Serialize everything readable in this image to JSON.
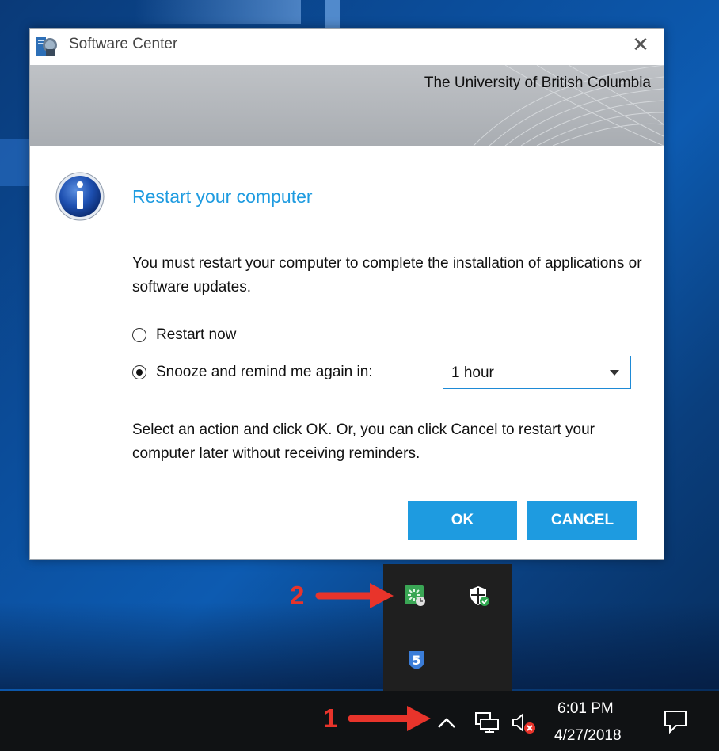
{
  "window": {
    "title": "Software Center",
    "close_label": "✕",
    "banner_org": "The University of British Columbia"
  },
  "dialog": {
    "heading": "Restart your computer",
    "message1": "You must restart your computer to complete the installation of applications or software updates.",
    "option_restart": "Restart now",
    "option_snooze": "Snooze and remind me again in:",
    "selected_option": "snooze",
    "snooze_value": "1 hour",
    "message2": "Select an action and click OK.  Or, you can click Cancel to restart your computer later without receiving reminders.",
    "ok_label": "OK",
    "cancel_label": "CANCEL"
  },
  "annotations": {
    "step1": "1",
    "step2": "2"
  },
  "tray_flyout": {
    "icons": [
      "software-center-tray-icon",
      "windows-defender-shield-icon",
      "sophos-tray-icon"
    ]
  },
  "taskbar": {
    "time": "6:01 PM",
    "date": "4/27/2018",
    "icons": [
      "show-hidden-icons-chevron-icon",
      "network-icon",
      "volume-muted-icon",
      "action-center-icon"
    ]
  },
  "colors": {
    "accent": "#1e9be0",
    "annotation": "#e8342b",
    "taskbar": "#101214"
  }
}
